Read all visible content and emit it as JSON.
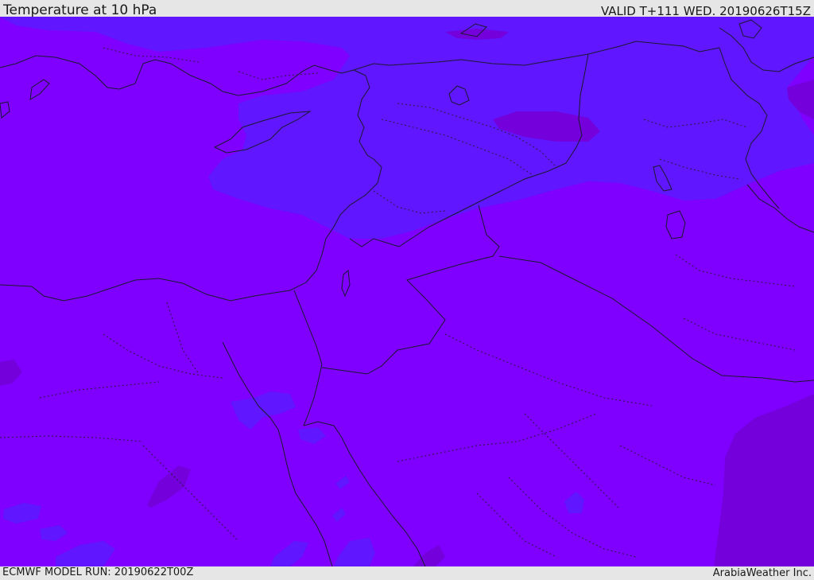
{
  "header": {
    "title": "Temperature at 10 hPa",
    "valid": "VALID T+111 WED. 20190626T15Z"
  },
  "footer": {
    "model_run": "ECMWF MODEL RUN: 20190622T00Z",
    "credit": "ArabiaWeather Inc."
  },
  "map": {
    "background_color": "#7f00ff",
    "cool_patch_color": "#6016ff",
    "warm_patch_color": "#7400dc",
    "border_color": "#1a1a2e"
  }
}
